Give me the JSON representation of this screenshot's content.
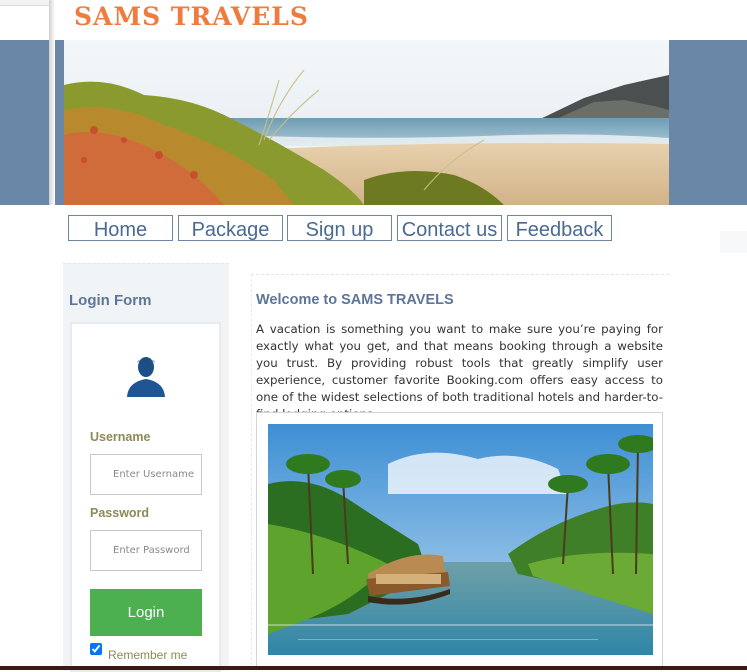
{
  "site": {
    "logo": "SAMS TRAVELS"
  },
  "nav": {
    "items": [
      {
        "label": "Home"
      },
      {
        "label": "Package"
      },
      {
        "label": "Sign up"
      },
      {
        "label": "Contact us"
      },
      {
        "label": "Feedback"
      }
    ]
  },
  "login": {
    "title": "Login Form",
    "username_label": "Username",
    "username_placeholder": "Enter Username",
    "password_label": "Password",
    "password_placeholder": "Enter Password",
    "login_button": "Login",
    "remember_label": "Remember me",
    "remember_checked": true
  },
  "content": {
    "title": "Welcome to SAMS TRAVELS",
    "paragraph": "A vacation is something you want to make sure you’re paying for exactly what you get, and that means booking through a website you trust. By providing robust tools that greatly simplify user experience, customer favorite Booking.com offers easy access to one of the widest selections of both traditional hotels and harder-to-find lodging options."
  },
  "colors": {
    "brand": "#f07b3f",
    "header_band": "#6a87a8",
    "heading": "#5d7699",
    "login_button": "#4caf50",
    "label": "#8d8a55"
  },
  "icons": {
    "avatar": "user-avatar-icon"
  }
}
